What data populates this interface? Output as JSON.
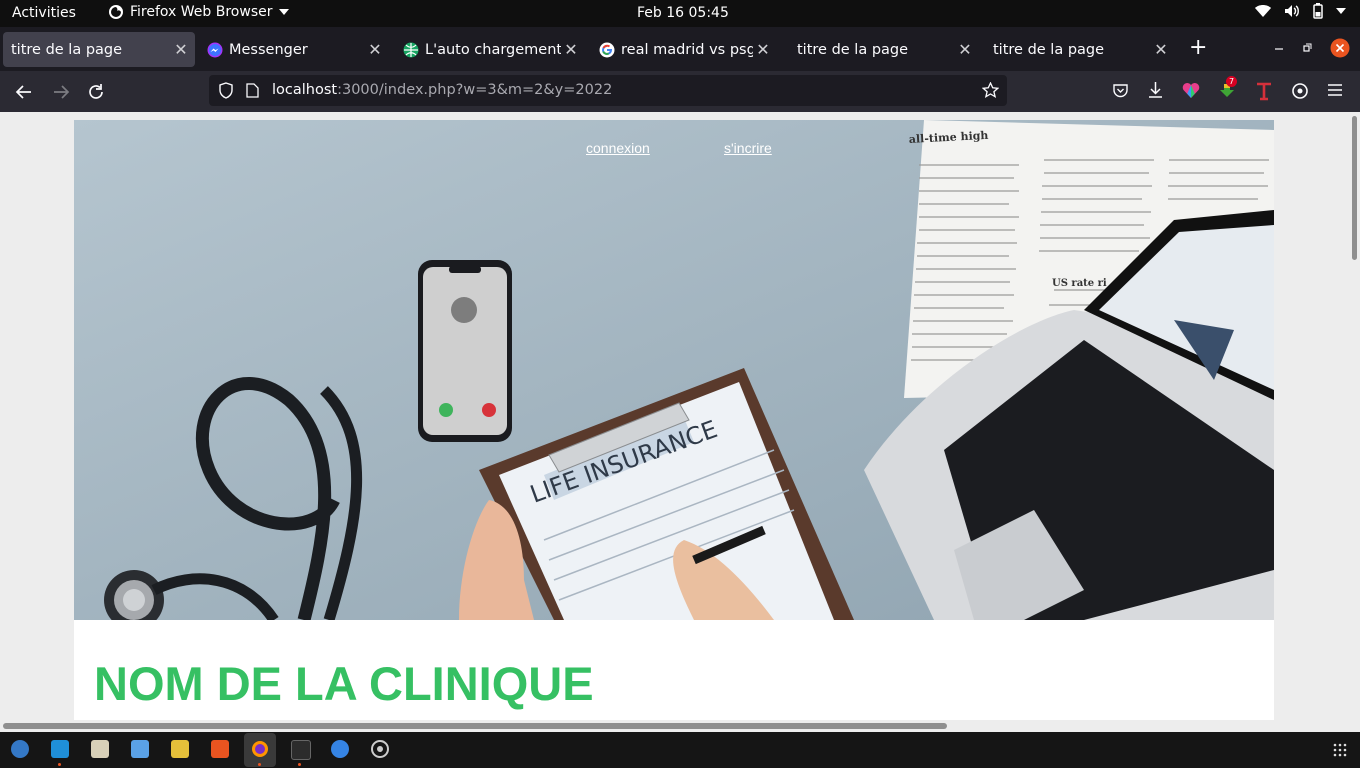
{
  "system": {
    "activities": "Activities",
    "app_menu": "Firefox Web Browser",
    "clock": "Feb 16  05:45"
  },
  "tabs": [
    {
      "title": "titre de la page",
      "active": true,
      "favicon": "none"
    },
    {
      "title": "Messenger",
      "active": false,
      "favicon": "messenger-icon"
    },
    {
      "title": "L'auto chargement de",
      "active": false,
      "favicon": "globe-green-icon"
    },
    {
      "title": "real madrid vs psg - R",
      "active": false,
      "favicon": "google-icon"
    },
    {
      "title": "titre de la page",
      "active": false,
      "favicon": "none"
    },
    {
      "title": "titre de la page",
      "active": false,
      "favicon": "none"
    }
  ],
  "urlbar": {
    "host": "localhost",
    "rest": ":3000/index.php?w=3&m=2&y=2022"
  },
  "page": {
    "nav_links": [
      "connexion",
      "s'incrire"
    ],
    "hero_image": {
      "header": "all-time high",
      "form": "LIFE INSURANCE",
      "paper_subhead": "US rate ri"
    },
    "clinic_name": "NOM DE LA CLINIQUE"
  },
  "extensions": {
    "badge_count": "7"
  },
  "colors": {
    "clinic_title": "#36c063",
    "hero_background": "#a7b8c3",
    "tab_active": "#42414d",
    "toolbar": "#2b2a33",
    "close_button": "#e95420"
  }
}
